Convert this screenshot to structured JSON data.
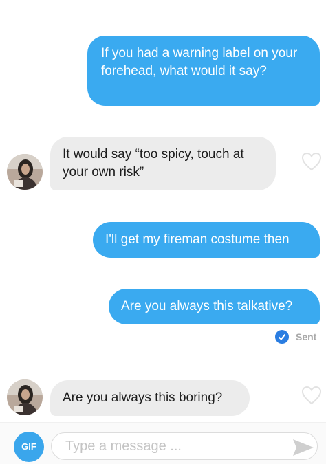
{
  "messages": [
    {
      "direction": "outgoing",
      "text": "If you had a warning label on your forehead, what would it say?"
    },
    {
      "direction": "incoming",
      "text": "It would say “too spicy, touch at your own risk”"
    },
    {
      "direction": "outgoing",
      "text": "I'll get my fireman costume then"
    },
    {
      "direction": "outgoing",
      "text": "Are you always this talkative?"
    },
    {
      "direction": "incoming",
      "text": "Are you always this boring?"
    }
  ],
  "status": {
    "label": "Sent"
  },
  "composer": {
    "gif_label": "GIF",
    "placeholder": "Type a message ..."
  },
  "icons": {
    "heart": "heart-outline-icon",
    "status": "blue-checkmark-icon",
    "send": "send-arrow-icon"
  },
  "colors": {
    "outgoing_bubble": "#3aaaf0",
    "incoming_bubble": "#ececec",
    "gif_button": "#3aa6ec",
    "sent_check": "#2a7de1"
  }
}
